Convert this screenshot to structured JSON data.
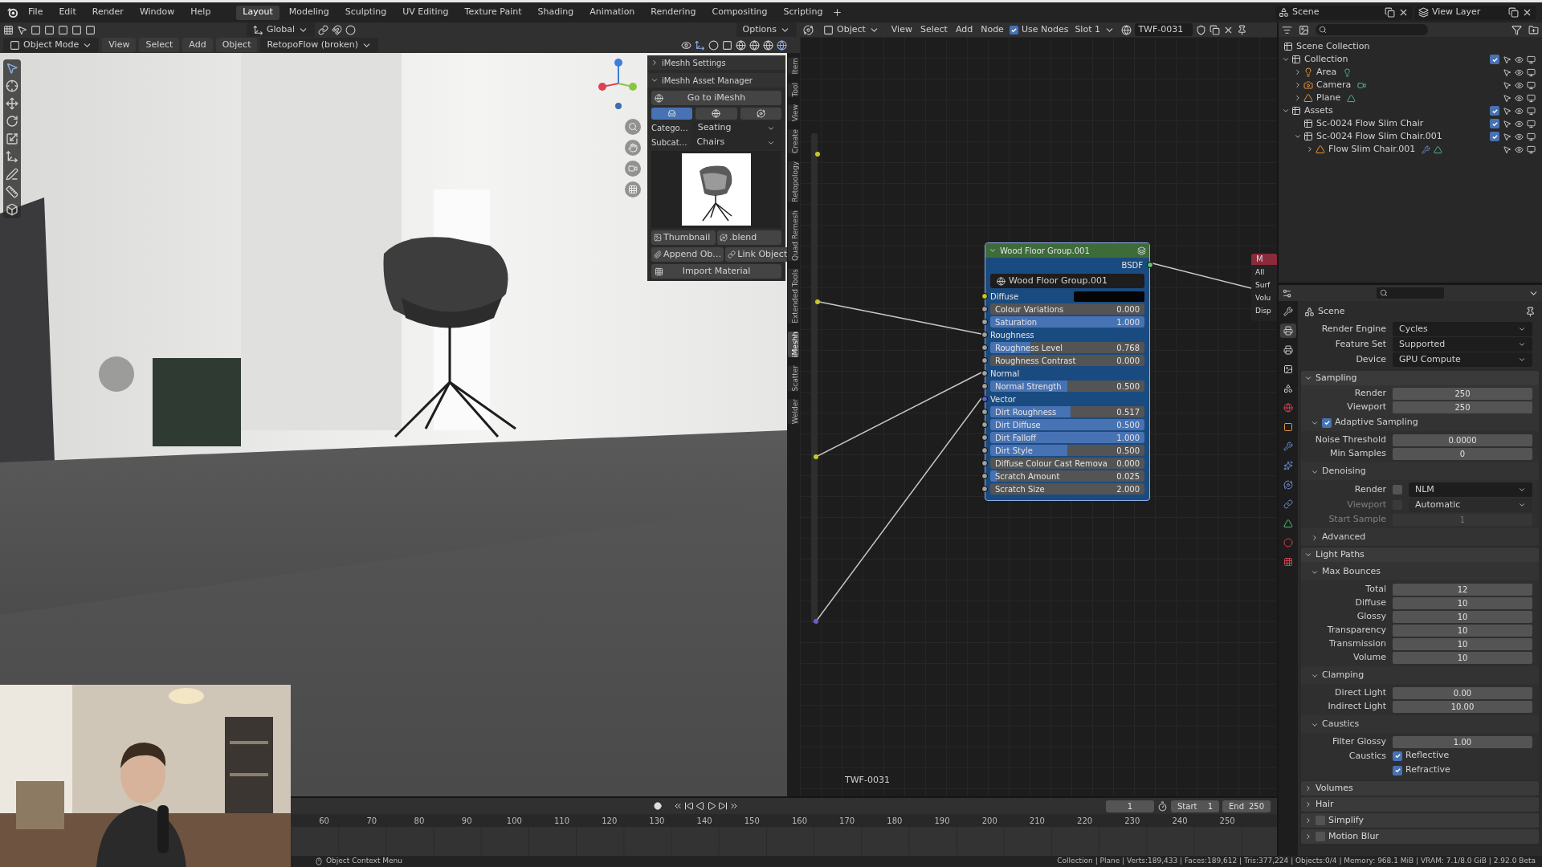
{
  "top_menu": [
    "File",
    "Edit",
    "Render",
    "Window",
    "Help"
  ],
  "workspaces": [
    {
      "label": "Layout",
      "selected": true
    },
    {
      "label": "Modeling",
      "selected": false
    },
    {
      "label": "Sculpting",
      "selected": false
    },
    {
      "label": "UV Editing",
      "selected": false
    },
    {
      "label": "Texture Paint",
      "selected": false
    },
    {
      "label": "Shading",
      "selected": false
    },
    {
      "label": "Animation",
      "selected": false
    },
    {
      "label": "Rendering",
      "selected": false
    },
    {
      "label": "Compositing",
      "selected": false
    },
    {
      "label": "Scripting",
      "selected": false
    }
  ],
  "scene": "Scene",
  "view_layer": "View Layer",
  "viewport": {
    "orientation": "Global",
    "options": "Options",
    "mode": "Object Mode",
    "menus": [
      "View",
      "Select",
      "Add",
      "Object"
    ],
    "addon_menu": "RetopoFlow (broken)",
    "sidebar_tabs": [
      {
        "label": "Item",
        "selected": false
      },
      {
        "label": "Tool",
        "selected": false
      },
      {
        "label": "View",
        "selected": false
      },
      {
        "label": "Create",
        "selected": false
      },
      {
        "label": "Retopology",
        "selected": false
      },
      {
        "label": "Quad Remesh",
        "selected": false
      },
      {
        "label": "Extended Tools",
        "selected": false
      },
      {
        "label": "iMeshh",
        "selected": true
      },
      {
        "label": "Scatter",
        "selected": false
      },
      {
        "label": "Welder",
        "selected": false
      }
    ],
    "imeshh": {
      "panels": [
        {
          "title": "iMeshh Settings",
          "expanded": false
        },
        {
          "title": "iMeshh Asset Manager",
          "expanded": true
        }
      ],
      "go_button": "Go to iMeshh",
      "asset_types": [
        {
          "kind": "object",
          "selected": true
        },
        {
          "kind": "material",
          "selected": false
        },
        {
          "kind": "world",
          "selected": false
        }
      ],
      "category": {
        "label": "Catego…",
        "value": "Seating"
      },
      "subcategory": {
        "label": "Subcat…",
        "value": "Chairs"
      },
      "thumbnail_button": "Thumbnail",
      "blend_button": ".blend",
      "append_button": "Append Ob…",
      "link_button": "Link Object",
      "import_button": "Import Material"
    }
  },
  "node_editor": {
    "object_type": "Object",
    "menus": [
      "View",
      "Select",
      "Add",
      "Node"
    ],
    "use_nodes": {
      "label": "Use Nodes",
      "checked": true
    },
    "slot": "Slot 1",
    "material": "TWF-0031",
    "frame_label": "TWF-0031",
    "node": {
      "title": "Wood Floor Group.001",
      "output": "BSDF",
      "group": "Wood Floor Group.001",
      "inputs": [
        {
          "kind": "color",
          "label": "Diffuse",
          "color": "#050505"
        },
        {
          "kind": "slider",
          "label": "Colour Variations",
          "value": "0.000",
          "level": 0
        },
        {
          "kind": "slider",
          "label": "Saturation",
          "value": "1.000",
          "level": 1
        },
        {
          "kind": "socket",
          "label": "Roughness"
        },
        {
          "kind": "slider",
          "label": "Roughness Level",
          "value": "0.768",
          "level": 0.26
        },
        {
          "kind": "slider",
          "label": "Roughness Contrast",
          "value": "0.000",
          "level": 0
        },
        {
          "kind": "socket",
          "label": "Normal"
        },
        {
          "kind": "slider",
          "label": "Normal Strength",
          "value": "0.500",
          "level": 0.5
        },
        {
          "kind": "socket",
          "label": "Vector"
        },
        {
          "kind": "slider",
          "label": "Dirt Roughness",
          "value": "0.517",
          "level": 0.52
        },
        {
          "kind": "slider",
          "label": "Dirt Diffuse",
          "value": "0.500",
          "level": 1
        },
        {
          "kind": "slider",
          "label": "Dirt Falloff",
          "value": "1.000",
          "level": 1
        },
        {
          "kind": "slider",
          "label": "Dirt Style",
          "value": "0.500",
          "level": 0.5
        },
        {
          "kind": "slider",
          "label": "Diffuse Colour Cast Remova",
          "value": "0.000",
          "level": 0
        },
        {
          "kind": "slider",
          "label": "Scratch Amount",
          "value": "0.025",
          "level": 0.04
        },
        {
          "kind": "slider",
          "label": "Scratch Size",
          "value": "2.000",
          "level": 0
        }
      ]
    },
    "output_node": {
      "title": "M",
      "sockets": [
        "All",
        "Surf",
        "Volu",
        "Disp"
      ]
    }
  },
  "outliner": {
    "root": "Scene Collection",
    "items": [
      {
        "kind": "collection",
        "label": "Collection",
        "checked": true,
        "expanded": true,
        "children": [
          {
            "kind": "light",
            "label": "Area",
            "expanded": false,
            "modifier": false
          },
          {
            "kind": "camera",
            "label": "Camera",
            "expanded": false,
            "modifier": false
          },
          {
            "kind": "mesh",
            "label": "Plane",
            "expanded": false,
            "modifier": false
          }
        ]
      },
      {
        "kind": "collection",
        "label": "Assets",
        "checked": true,
        "expanded": true,
        "children": [
          {
            "kind": "collection",
            "label": "Sc-0024 Flow Slim Chair",
            "checked": true
          },
          {
            "kind": "collection",
            "label": "Sc-0024 Flow Slim Chair.001",
            "checked": true,
            "expanded": true,
            "children": [
              {
                "kind": "mesh",
                "label": "Flow Slim Chair.001",
                "expanded": false,
                "modifier": true
              }
            ]
          }
        ]
      }
    ]
  },
  "properties": {
    "tabs": [
      {
        "kind": "tool",
        "selected": false
      },
      {
        "kind": "render",
        "selected": true
      },
      {
        "kind": "output",
        "selected": false
      },
      {
        "kind": "view_layer",
        "selected": false
      },
      {
        "kind": "scene",
        "selected": false
      },
      {
        "kind": "world",
        "selected": false
      },
      {
        "kind": "object",
        "selected": false
      },
      {
        "kind": "modifiers",
        "selected": false
      },
      {
        "kind": "particles",
        "selected": false
      },
      {
        "kind": "physics",
        "selected": false
      },
      {
        "kind": "constraints",
        "selected": false
      },
      {
        "kind": "data",
        "selected": false
      },
      {
        "kind": "material",
        "selected": false
      },
      {
        "kind": "texture",
        "selected": false
      }
    ],
    "context": "Scene",
    "top_rows": [
      {
        "kind": "dropdown",
        "label": "Render Engine",
        "value": "Cycles"
      },
      {
        "kind": "dropdown",
        "label": "Feature Set",
        "value": "Supported"
      },
      {
        "kind": "dropdown",
        "label": "Device",
        "value": "GPU Compute"
      }
    ],
    "panels": [
      {
        "title": "Sampling",
        "expanded": true,
        "items": [
          {
            "kind": "number",
            "label": "Render",
            "value": "250"
          },
          {
            "kind": "number",
            "label": "Viewport",
            "value": "250"
          },
          {
            "kind": "subpanel",
            "title": "Adaptive Sampling",
            "checked": true,
            "expanded": true,
            "items": [
              {
                "kind": "number",
                "label": "Noise Threshold",
                "value": "0.0000"
              },
              {
                "kind": "number",
                "label": "Min Samples",
                "value": "0"
              }
            ]
          },
          {
            "kind": "subpanel",
            "title": "Denoising",
            "expanded": true,
            "items": [
              {
                "kind": "check_dropdown",
                "label": "Render",
                "checked": false,
                "value": "NLM",
                "disabled": false
              },
              {
                "kind": "check_dropdown",
                "label": "Viewport",
                "checked": false,
                "value": "Automatic",
                "disabled": true
              },
              {
                "kind": "number",
                "label": "Start Sample",
                "value": "1",
                "disabled": true
              }
            ]
          },
          {
            "kind": "subpanel",
            "title": "Advanced",
            "expanded": false
          }
        ]
      },
      {
        "title": "Light Paths",
        "expanded": true,
        "items": [
          {
            "kind": "subpanel",
            "title": "Max Bounces",
            "expanded": true,
            "items": [
              {
                "kind": "number",
                "label": "Total",
                "value": "12"
              },
              {
                "kind": "number",
                "label": "Diffuse",
                "value": "10"
              },
              {
                "kind": "number",
                "label": "Glossy",
                "value": "10"
              },
              {
                "kind": "number",
                "label": "Transparency",
                "value": "10"
              },
              {
                "kind": "number",
                "label": "Transmission",
                "value": "10"
              },
              {
                "kind": "number",
                "label": "Volume",
                "value": "10"
              }
            ]
          },
          {
            "kind": "subpanel",
            "title": "Clamping",
            "expanded": true,
            "items": [
              {
                "kind": "number",
                "label": "Direct Light",
                "value": "0.00"
              },
              {
                "kind": "number",
                "label": "Indirect Light",
                "value": "10.00"
              }
            ]
          },
          {
            "kind": "subpanel",
            "title": "Caustics",
            "expanded": true,
            "items": [
              {
                "kind": "number",
                "label": "Filter Glossy",
                "value": "1.00"
              },
              {
                "kind": "checkbox",
                "label": "Caustics",
                "text": "Reflective",
                "checked": true
              },
              {
                "kind": "checkbox",
                "text": "Refractive",
                "checked": true
              }
            ]
          }
        ]
      },
      {
        "title": "Volumes",
        "expanded": false
      },
      {
        "title": "Hair",
        "expanded": false
      },
      {
        "title": "Simplify",
        "expanded": false,
        "checked": false
      },
      {
        "title": "Motion Blur",
        "expanded": false,
        "checked": false
      }
    ]
  },
  "timeline": {
    "current_frame": "1",
    "start_label": "Start",
    "start": "1",
    "end_label": "End",
    "end": "250",
    "ticks": [
      "60",
      "70",
      "80",
      "90",
      "100",
      "110",
      "120",
      "130",
      "140",
      "150",
      "160",
      "170",
      "180",
      "190",
      "200",
      "210",
      "220",
      "230",
      "240",
      "250"
    ]
  },
  "status_bar": {
    "hint": "Object Context Menu",
    "stats": "Collection | Plane | Verts:189,433 | Faces:189,612 | Tris:377,224 | Objects:0/4 | Memory: 968.1 MiB | VRAM: 7.1/8.0 GiB | 2.92.0 Beta"
  }
}
